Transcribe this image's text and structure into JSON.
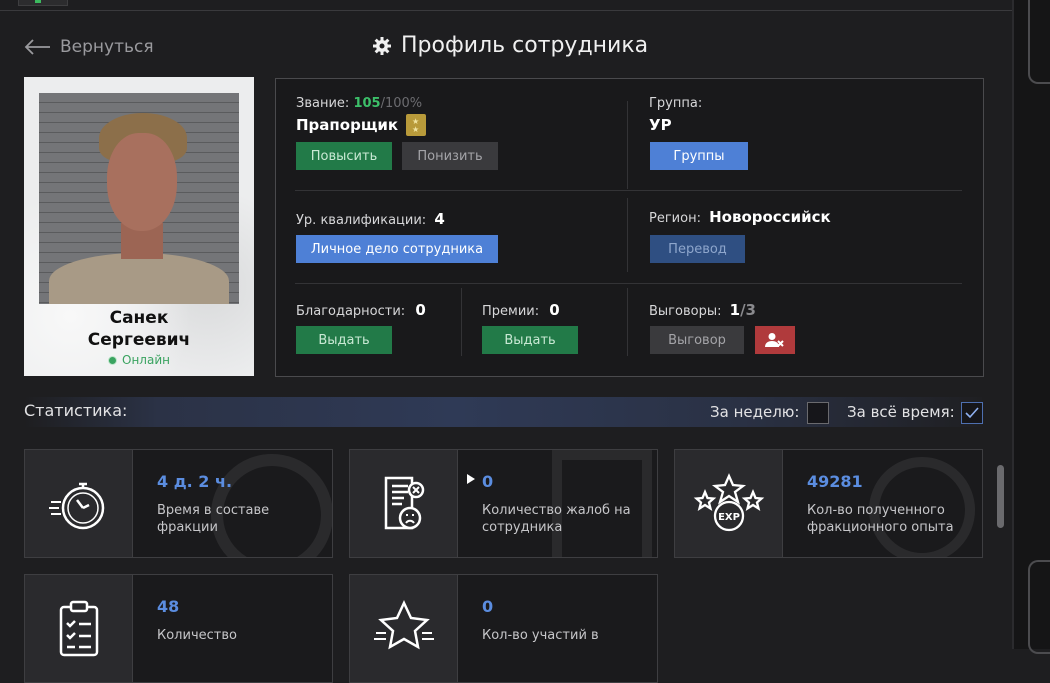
{
  "header": {
    "back_label": "Вернуться",
    "title": "Профиль сотрудника"
  },
  "profile": {
    "first_name": "Санек",
    "last_name": "Сергеевич",
    "status": "Онлайн"
  },
  "rank": {
    "label": "Звание:",
    "progress_value": "105",
    "progress_max": "/100%",
    "name": "Прапорщик",
    "promote_label": "Повысить",
    "demote_label": "Понизить"
  },
  "group": {
    "label": "Группа:",
    "value": "УР",
    "button_label": "Группы"
  },
  "qualification": {
    "label": "Ур. квалификации:",
    "value": "4",
    "button_label": "Личное дело сотрудника"
  },
  "region": {
    "label": "Регион:",
    "value": "Новороссийск",
    "button_label": "Перевод"
  },
  "thanks": {
    "label": "Благодарности:",
    "value": "0",
    "button_label": "Выдать"
  },
  "bonuses": {
    "label": "Премии:",
    "value": "0",
    "button_label": "Выдать"
  },
  "reprimands": {
    "label": "Выговоры:",
    "value": "1",
    "max": "/3",
    "button_label": "Выговор"
  },
  "statistics": {
    "label": "Статистика:",
    "week_label": "За неделю:",
    "week_checked": false,
    "all_time_label": "За всё время:",
    "all_time_checked": true,
    "accent_color": "#5b8de0"
  },
  "cards": [
    {
      "icon": "stopwatch-icon",
      "value": "4 д. 2 ч.",
      "text": "Время в составе фракции"
    },
    {
      "icon": "complaint-document-icon",
      "value": "0",
      "text": "Количество жалоб на сотрудника"
    },
    {
      "icon": "exp-stars-icon",
      "value": "49281",
      "text": "Кол-во полученного фракционного опыта"
    },
    {
      "icon": "clipboard-checklist-icon",
      "value": "48",
      "text": "Количество"
    },
    {
      "icon": "star-icon",
      "value": "0",
      "text": "Кол-во участий в"
    }
  ]
}
